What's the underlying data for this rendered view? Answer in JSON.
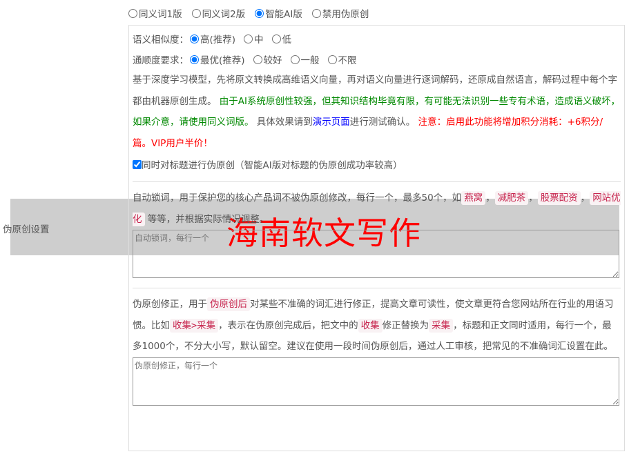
{
  "section_label": "伪原创设置",
  "modes": [
    "同义词1版",
    "同义词2版",
    "智能AI版",
    "禁用伪原创"
  ],
  "selected_mode": 2,
  "similarity": {
    "label": "语义相似度：",
    "options": [
      "高(推荐)",
      "中",
      "低"
    ]
  },
  "fluency": {
    "label": "通顺度要求：",
    "options": [
      "最优(推荐)",
      "较好",
      "一般",
      "不限"
    ]
  },
  "desc": {
    "p1": "基于深度学习模型，先将原文转换成高维语义向量，再对语义向量进行逐词解码，还原成自然语言，解码过程中每个字都由机器原创生成。",
    "p2": " 由于AI系统原创性较强，但其知识结构毕竟有限，有可能无法识别一些专有术语，造成语义破坏，如果介意，请使用同义词版。",
    "p3": " 具体效果请到",
    "link": "演示页面",
    "p4": "进行测试确认。",
    "p5": " 注意：启用此功能将增加积分消耗：+6积分/篇。VIP用户半价！"
  },
  "title_checkbox": "同时对标题进行伪原创（智能AI版对标题的伪原创成功率较高）",
  "lock": {
    "t1": "自动锁词，用于保护您的核心产品词不被伪原创修改，每行一个，最多50个，如",
    "e1": "燕窝",
    "e2": "减肥茶",
    "e3": "股票配资",
    "e4": "网站优化",
    "t2": " 等等，并根据实际情况调整。",
    "placeholder": "自动锁词，每行一个",
    "sep": "，"
  },
  "fix": {
    "t1": "伪原创修正，用于",
    "c1": "伪原创后",
    "t2": "对某些不准确的词汇进行修正，提高文章可读性，使文章更符合您网站所在行业的用语习惯。比如",
    "c2": "收集>采集",
    "t3": "，表示在伪原创完成后，把文中的",
    "c3": "收集",
    "t4": "修正替换为",
    "c4": "采集",
    "t5": "，标题和正文同时适用，每行一个，最多1000个，不分大小写，默认留空。建议在使用一段时间伪原创后，通过人工审核，把常见的不准确词汇设置在此。",
    "placeholder": "伪原创修正，每行一个"
  },
  "watermark": "海南软文写作"
}
